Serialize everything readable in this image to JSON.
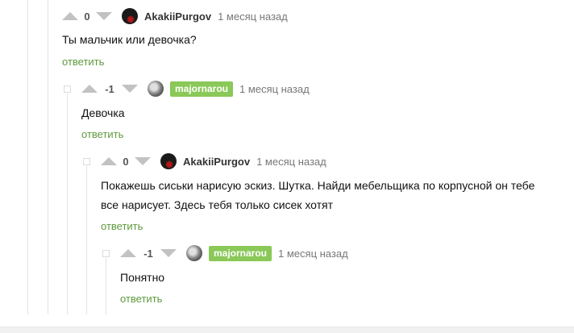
{
  "comments": [
    {
      "score": "0",
      "author": "AkakiiPurgov",
      "time": "1 месяц назад",
      "text": "Ты мальчик или девочка?",
      "reply": "ответить"
    },
    {
      "score": "-1",
      "author": "majornarou",
      "time": "1 месяц назад",
      "text": "Девочка",
      "reply": "ответить"
    },
    {
      "score": "0",
      "author": "AkakiiPurgov",
      "time": "1 месяц назад",
      "text_line1": "Покажешь сиськи нарисую эскиз. Шутка. Найди мебельщика по корпусной он тебе",
      "text_line2": "все нарисует. Здесь тебя только сисек хотят",
      "reply": "ответить"
    },
    {
      "score": "-1",
      "author": "majornarou",
      "time": "1 месяц назад",
      "text": "Понятно",
      "reply": "ответить"
    }
  ],
  "icons": {
    "upvote": "arrow-up-icon",
    "downvote": "arrow-down-icon",
    "collapse": "collapse-icon"
  },
  "colors": {
    "reply_link": "#5e9a3d",
    "author_badge": "#8ac858",
    "vote_arrow": "#c2c2c2"
  }
}
